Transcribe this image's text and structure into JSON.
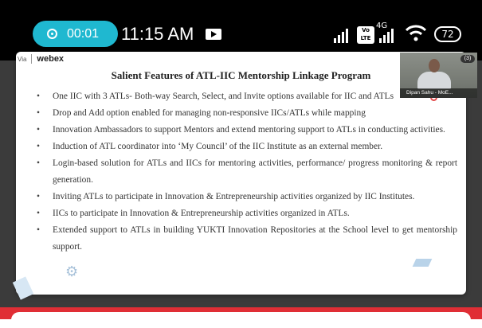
{
  "status_bar": {
    "recording_time": "00:01",
    "clock": "11:15 AM",
    "network_type": "4G",
    "volte_label_top": "Vo",
    "volte_label_bottom": "LTE",
    "battery_level": "72",
    "icons": [
      "record-icon",
      "cast-icon",
      "signal-icon",
      "volte-icon",
      "signal-icon",
      "wifi-icon",
      "battery-icon"
    ]
  },
  "webex_logo": {
    "via": "Via",
    "brand": "webex"
  },
  "slide": {
    "title": "Salient Features of ATL-IIC Mentorship Linkage Program",
    "bullets": [
      "One IIC with 3 ATLs- Both-way Search, Select, and Invite options available for IIC and ATLs",
      "Drop and Add option enabled for managing non-responsive IICs/ATLs while mapping",
      "Innovation Ambassadors to support Mentors and extend mentoring support to ATLs in conducting activities.",
      "Induction of ATL coordinator into ‘My Council’ of the IIC Institute as an external member.",
      "Login-based solution for ATLs and IICs for mentoring activities, performance/ progress monitoring & report generation.",
      "Inviting ATLs to participate in Innovation & Entrepreneurship activities organized by IIC Institutes.",
      "IICs to participate in Innovation & Entrepreneurship activities organized in ATLs.",
      "Extended support to ATLs in building YUKTI Innovation Repositories at the School level to get mentorship support."
    ]
  },
  "video_tile": {
    "participant_name": "Dipan Sahu - MoE...",
    "badge": "(3)"
  },
  "colors": {
    "recording_pill": "#1fb8d0",
    "bottom_strip": "#e02e35",
    "meeting_background": "#3b3b3b"
  }
}
